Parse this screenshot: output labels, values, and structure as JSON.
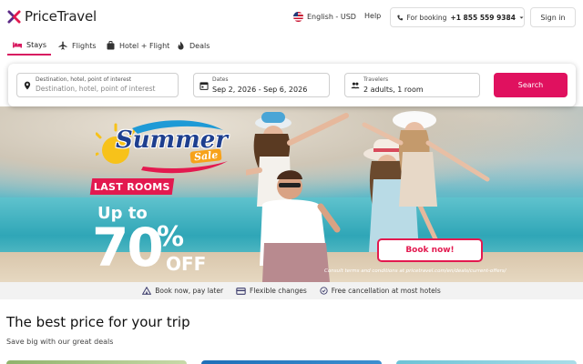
{
  "header": {
    "logo_text": "PriceTravel",
    "language": "English - USD",
    "help": "Help",
    "booking_prefix": "For booking",
    "booking_phone": "+1 855 559 9384",
    "signin": "Sign in"
  },
  "tabs": [
    {
      "label": "Stays",
      "icon": "bed-icon",
      "active": true
    },
    {
      "label": "Flights",
      "icon": "plane-icon",
      "active": false
    },
    {
      "label": "Hotel + Flight",
      "icon": "suitcase-icon",
      "active": false
    },
    {
      "label": "Deals",
      "icon": "fire-icon",
      "active": false
    }
  ],
  "search": {
    "destination_label": "Destination, hotel, point of interest",
    "destination_placeholder": "Destination, hotel, point of interest",
    "dates_label": "Dates",
    "dates_value": "Sep 2, 2026 - Sep 6, 2026",
    "travelers_label": "Travelers",
    "travelers_value": "2 adults, 1 room",
    "button": "Search"
  },
  "hero": {
    "headline": "Summer",
    "headline_sub": "Sale",
    "badge": "LAST ROOMS",
    "upto": "Up to",
    "discount_number": "70",
    "discount_sign": "%",
    "discount_off": "OFF",
    "cta": "Book now!",
    "terms": "Consult terms and conditions at pricetravel.com/en/deals/current-offers/"
  },
  "benefits": [
    {
      "label": "Book now, pay later",
      "icon": "tent-icon"
    },
    {
      "label": "Flexible changes",
      "icon": "card-icon"
    },
    {
      "label": "Free cancellation at most hotels",
      "icon": "check-circle-icon"
    }
  ],
  "section": {
    "title": "The best price for your trip",
    "subtitle": "Save big with our great deals"
  },
  "colors": {
    "accent": "#e0115f",
    "brand_purple": "#5b2a86",
    "brand_pink": "#e3194f"
  }
}
